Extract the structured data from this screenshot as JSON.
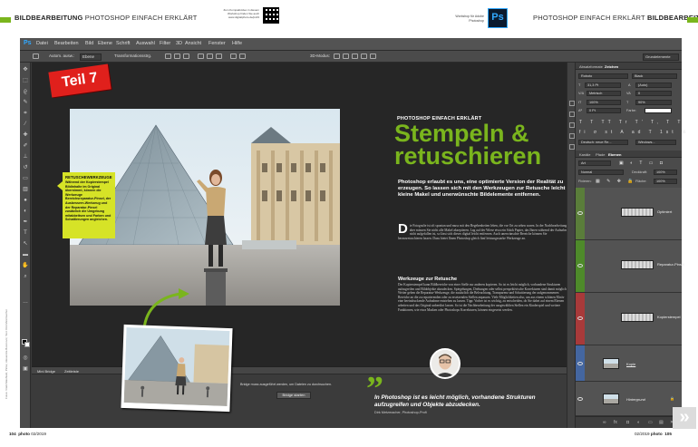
{
  "magazine": {
    "left_header_bold": "BILDBEARBEITUNG",
    "left_header_light": "PHOTOSHOP EINFACH ERKLÄRT",
    "right_header_light": "PHOTOSHOP EINFACH ERKLÄRT",
    "right_header_bold": "BILDBEARBEITUNG",
    "qr_note": "Zum Kompaktvideo in diesem Workshop finden Sie auch www.digitalphoto.de/ps33",
    "ps_note": "Workshop für Adobe Photoshop",
    "ps_logo": "Ps",
    "accent": "#7ab51d",
    "footer_left_page": "104",
    "footer_left_brand": "photo",
    "footer_left_issue": "02/2019",
    "footer_right_issue": "02/2019",
    "footer_right_brand": "photo",
    "footer_right_page": "105",
    "side_credit": "Fotos: Vitalii Mashtalir, Pinter, Alexandra Bozorovic; Text: Dirk Metzmacher"
  },
  "photoshop": {
    "app_logo": "Ps",
    "menu": [
      "Datei",
      "Bearbeiten",
      "Bild",
      "Ebene",
      "Schrift",
      "Auswahl",
      "Filter",
      "3D",
      "Ansicht",
      "Fenster",
      "Hilfe"
    ],
    "options": {
      "auto_select_label": "Autom. ausw.:",
      "auto_select_value": "Ebene",
      "transform_label": "Transformationsstrg.",
      "mode_3d_label": "3D-Modus:",
      "workspace": "Grundelemente"
    },
    "bottom_tabs": [
      "Mini Bridge",
      "Zeitleiste"
    ],
    "bridge_message": "Bridge muss ausgeführt werden, um Dateien zu durchsuchen.",
    "bridge_button": "Bridge starten"
  },
  "article": {
    "part_badge": "Teil 7",
    "kicker": "PHOTOSHOP EINFACH ERKLÄRT",
    "title_line1": "Stempeln &",
    "title_line2": "retuschieren",
    "lead": "Photoshop erlaubt es uns, eine optimierte Version der Realität zu erzeugen. So lassen sich mit den Werkzeugen zur Retusche leicht kleine Makel und unerwünschte Bildelemente entfernen.",
    "dropcap": "D",
    "body1": "ie Fotografie ist oft spontan und muss mit den Begebenheiten leben, die vor Ort zu sehen waren. In der Nachbearbeitung aber müssen Sie nicht alle Makel akzeptieren. Lag auf der Wiese etwa ein Stück Papier, das Ihnen während der Aufnahme nicht aufgefallen ist, so lässt sich dieses digital leicht entfernen. Auch unerwünschte Bereiche können Sie herausretuschieren lassen. Dazu bietet Ihnen Photoshop gleich fünf leistungsstarke Werkzeuge an.",
    "subhead": "Werkzeuge zur Retusche",
    "body2": "Der Kopierstempel kann Bildbereiche von einer Stelle zur anderen kopieren. So ist es leicht möglich, vorhandene Strukturen aufzugreifen und Bildobjekte abzudecken. Spiegelungen, Drehungen oder selbst perspektivische Korrekturen sind damit möglich. Weiter geben die Reparatur-Werkzeuge, die zusätzlich die Beleuchtung, Transparenz und Schattierung der aufgenommenen Bereiche an die zu reparierenden oder zu ersetzenden Stellen anpassen. Viele Möglichkeiten also, um aus einem schönen Motiv eine beeindruckende Aufnahme entstehen zu lassen. Tipp: Vorher ist es wichtig, zu entscheiden, ob Sie dabei auf einem Ebenen arbeiten und das Original unberührt lassen. So ist die Nachbearbeitung der ausgewählten Stellen ein Kinderspiel und weitere Funktionen, wie etwa Masken oder Photoshops Korrekturen, können eingesetzt werden.",
    "callout_title": "RETUSCHEWERKZEUGE",
    "callout_body": "Während der Kopierstempel Bildinhalte im Original übernimmt, können die Werkzeuge Bereichsreparatur-Pinsel, der Ausbessern-Werkzeug und der Reparatur-Pinsel zusätzlich die Umgebung mitabbeitsen und Farben und Schattierungen angleichen.",
    "quote": "In Photoshop ist es leicht möglich, vorhandene Strukturen aufzugreifen und Objekte abzudecken.",
    "quote_author": "Dirk Metzmacher, Photoshop-Profi"
  },
  "panels": {
    "top_tabs": [
      "Absatzformate",
      "Zeichen"
    ],
    "font_family": "Roboto",
    "font_style": "Black",
    "font_size": "31,3 Pt",
    "leading": "(Auto)",
    "kerning": "Metrisch",
    "tracking": "0",
    "scale_v": "100%",
    "scale_h": "90%",
    "baseline": "0 Pt",
    "color_label": "Farbe:",
    "type_row": "T T TT Tr T' T, T T",
    "opentype_row": "fi σ st A ad T 1st ½",
    "language": "Deutsch: neue Re...",
    "antialias": "Windows...",
    "layer_tabs": [
      "Kanäle",
      "Pfade",
      "Ebenen"
    ],
    "filter": "Art",
    "blend_mode": "Normal",
    "opacity_label": "Deckkraft:",
    "opacity": "100%",
    "lock_label": "Fixieren:",
    "fill_label": "Fläche:",
    "fill": "100%",
    "layers": [
      {
        "name": "Optimiert",
        "color": "#8aa85a"
      },
      {
        "name": "Reparatur-Pinsel",
        "color": "#5fa232"
      },
      {
        "name": "Kopierstempel",
        "color": "#b43a3a"
      },
      {
        "name": "Kopie",
        "color": "#4a6aa8"
      },
      {
        "name": "Hintergrund",
        "color": "#535353"
      }
    ],
    "bottom_icons": "∞ fx ◘ ◐ ▭ ▤ 🗑"
  }
}
